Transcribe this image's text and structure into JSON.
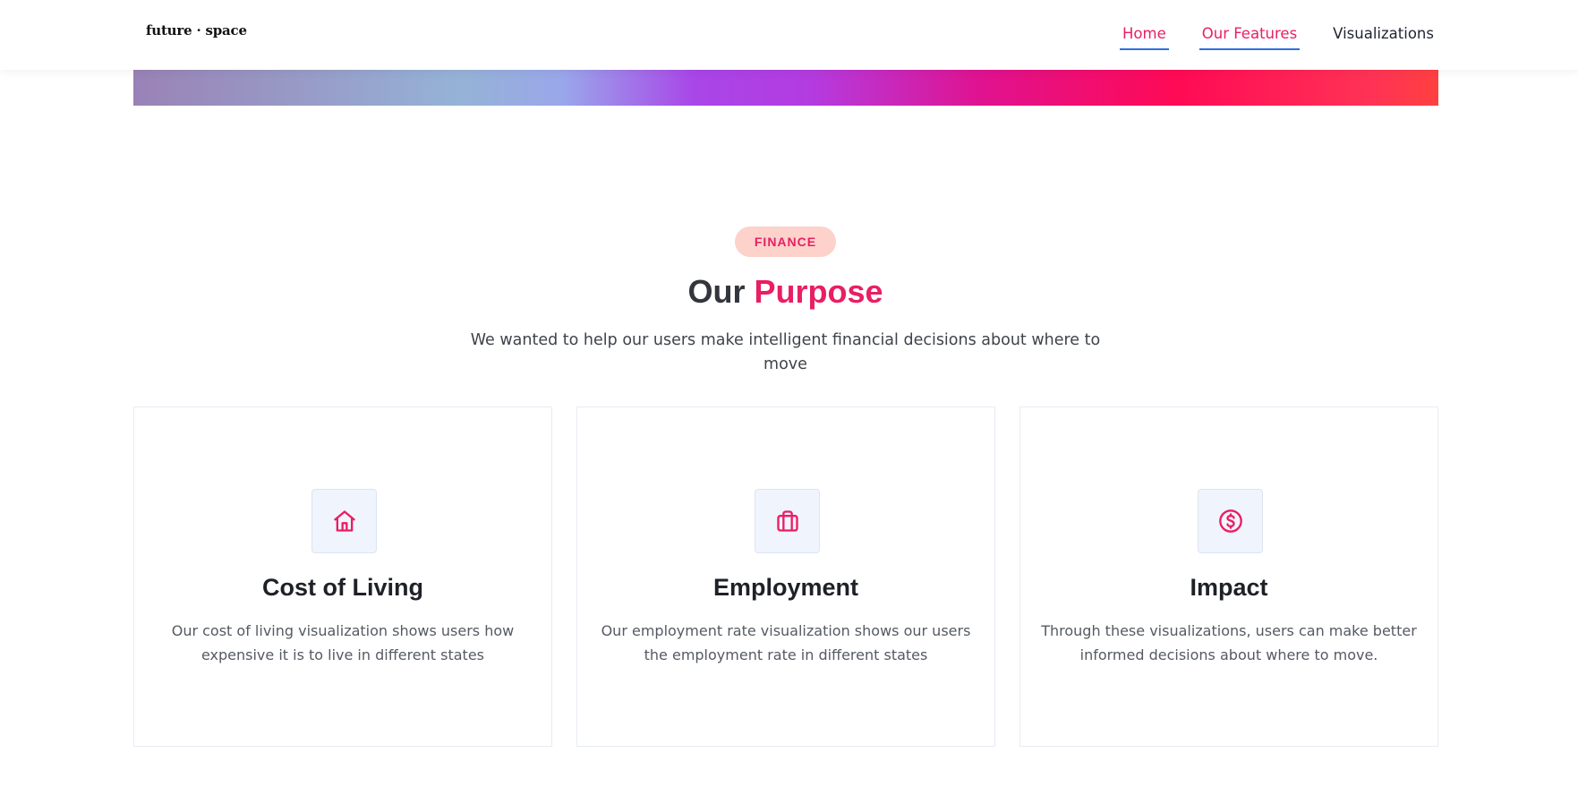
{
  "header": {
    "logo": "future · space",
    "nav": [
      {
        "label": "Home",
        "active": true
      },
      {
        "label": "Our Features",
        "active": true
      },
      {
        "label": "Visualizations",
        "active": false
      }
    ]
  },
  "hero": {
    "badge": "FINANCE",
    "title_plain": "Our ",
    "title_accent": "Purpose",
    "subtitle": "We wanted to help our users make intelligent financial decisions about where to move"
  },
  "cards": [
    {
      "icon": "home-icon",
      "title": "Cost of Living",
      "text": "Our cost of living visualization shows users how expensive it is to live in different states"
    },
    {
      "icon": "briefcase-icon",
      "title": "Employment",
      "text": "Our employment rate visualization shows our users the employment rate in different states"
    },
    {
      "icon": "dollar-circle-icon",
      "title": "Impact",
      "text": "Through these visualizations, users can make better informed decisions about where to move."
    }
  ],
  "colors": {
    "accent": "#e91e63",
    "badge_bg": "#fcd2cb",
    "nav_underline": "#2f6fdb",
    "icon_box_bg": "#f0f4fc"
  }
}
